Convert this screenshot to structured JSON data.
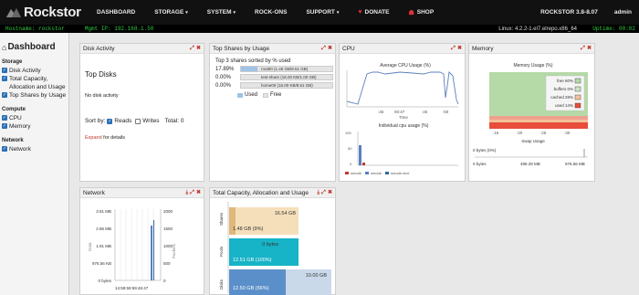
{
  "navbar": {
    "brand": "Rockstor",
    "items": [
      {
        "label": "DASHBOARD",
        "caret": false
      },
      {
        "label": "STORAGE",
        "caret": true
      },
      {
        "label": "SYSTEM",
        "caret": true
      },
      {
        "label": "ROCK-ONS",
        "caret": false
      },
      {
        "label": "SUPPORT",
        "caret": true
      },
      {
        "label": "DONATE",
        "caret": false
      },
      {
        "label": "SHOP",
        "caret": false
      }
    ],
    "version": "ROCKSTOR 3.8-8.07",
    "user": "admin"
  },
  "statusbar": {
    "hostname": "Hostname: rockstor",
    "mgmt_ip": "Mgmt IP: 192.168.1.50",
    "linux": "Linux: 4.2.2-1.el7.elrepo.x86_64",
    "uptime": "Uptime: 00:02"
  },
  "sidebar": {
    "title": "Dashboard",
    "groups": [
      {
        "name": "Storage",
        "items": [
          "Disk Activity",
          "Total Capacity, Allocation and Usage",
          "Top Shares by Usage"
        ]
      },
      {
        "name": "Compute",
        "items": [
          "CPU",
          "Memory"
        ]
      },
      {
        "name": "Network",
        "items": [
          "Network"
        ]
      }
    ]
  },
  "widgets": {
    "disk": {
      "title": "Disk Activity",
      "top": "Top Disks",
      "none": "No disk activity",
      "sort_label": "Sort by:",
      "reads": "Reads",
      "writes": "Writes",
      "total": "Total: 0",
      "expand_link": "Expand",
      "expand_rest": " for details"
    },
    "shares": {
      "title": "Top Shares by Usage",
      "subtitle": "Top 3 shares sorted by % used",
      "rows": [
        {
          "pct": "17.89%",
          "label": "root00 (1.46 GB/8.51 GB)",
          "fraction": 0.1789
        },
        {
          "pct": "0.00%",
          "label": "test-share (16.00 KB/1.00 GB)",
          "fraction": 0.0
        },
        {
          "pct": "0.00%",
          "label": "home00 (16.00 KB/8.51 GB)",
          "fraction": 0.0
        }
      ],
      "legend_used": "Used",
      "legend_free": "Free"
    },
    "cpu": {
      "title": "CPU",
      "avg_title": "Average CPU Usage (%)",
      "x_ticks": [
        ":45",
        "00:47",
        ":45",
        ":50"
      ],
      "x_label": "Time",
      "ind_title": "Individual cpu usage (%)",
      "y_ticks": [
        "100",
        "50",
        "0"
      ],
      "legend": [
        "smode",
        "smode",
        "smode.nice"
      ],
      "colors": {
        "a": "#5b7fbf",
        "b": "#c0392b",
        "c": "#2e6b9e"
      }
    },
    "memory": {
      "title": "Memory",
      "chart_title": "Memory Usage (%)",
      "legend": [
        "free 60%",
        "buffers 0%",
        "cached 28%",
        "used 14%"
      ],
      "x_ticks": [
        ":15",
        ":20",
        ":25",
        ":30"
      ],
      "swap_title": "Swap Usage",
      "swap_bytes": "0 bytes (0%)",
      "swap_ticks": [
        "0 bytes",
        "488.28 MB",
        "976.56 MB"
      ]
    },
    "network": {
      "title": "Network",
      "y_ticks": [
        "3.81 MB",
        "2.86 MB",
        "1.91 MB",
        "976.56 KB",
        "0 bytes"
      ],
      "y2_ticks": [
        "2000",
        "1500",
        "1000",
        "500",
        "0"
      ],
      "y_label": "Data",
      "y2_label": "Packets",
      "x_tick": "14:59:59:59:46:47"
    },
    "capacity": {
      "title": "Total Capacity, Allocation and Usage",
      "rows": [
        {
          "label": "Shares",
          "value_left": "1.48 GB (9%)",
          "value_right": "16.54 GB"
        },
        {
          "label": "Pools",
          "value_left": "12.51 GB (100%)",
          "value_right": "0 bytes"
        },
        {
          "label": "Disks",
          "value_left": "12.50 GB (56%)",
          "value_right": "10.00 GB"
        }
      ]
    }
  }
}
